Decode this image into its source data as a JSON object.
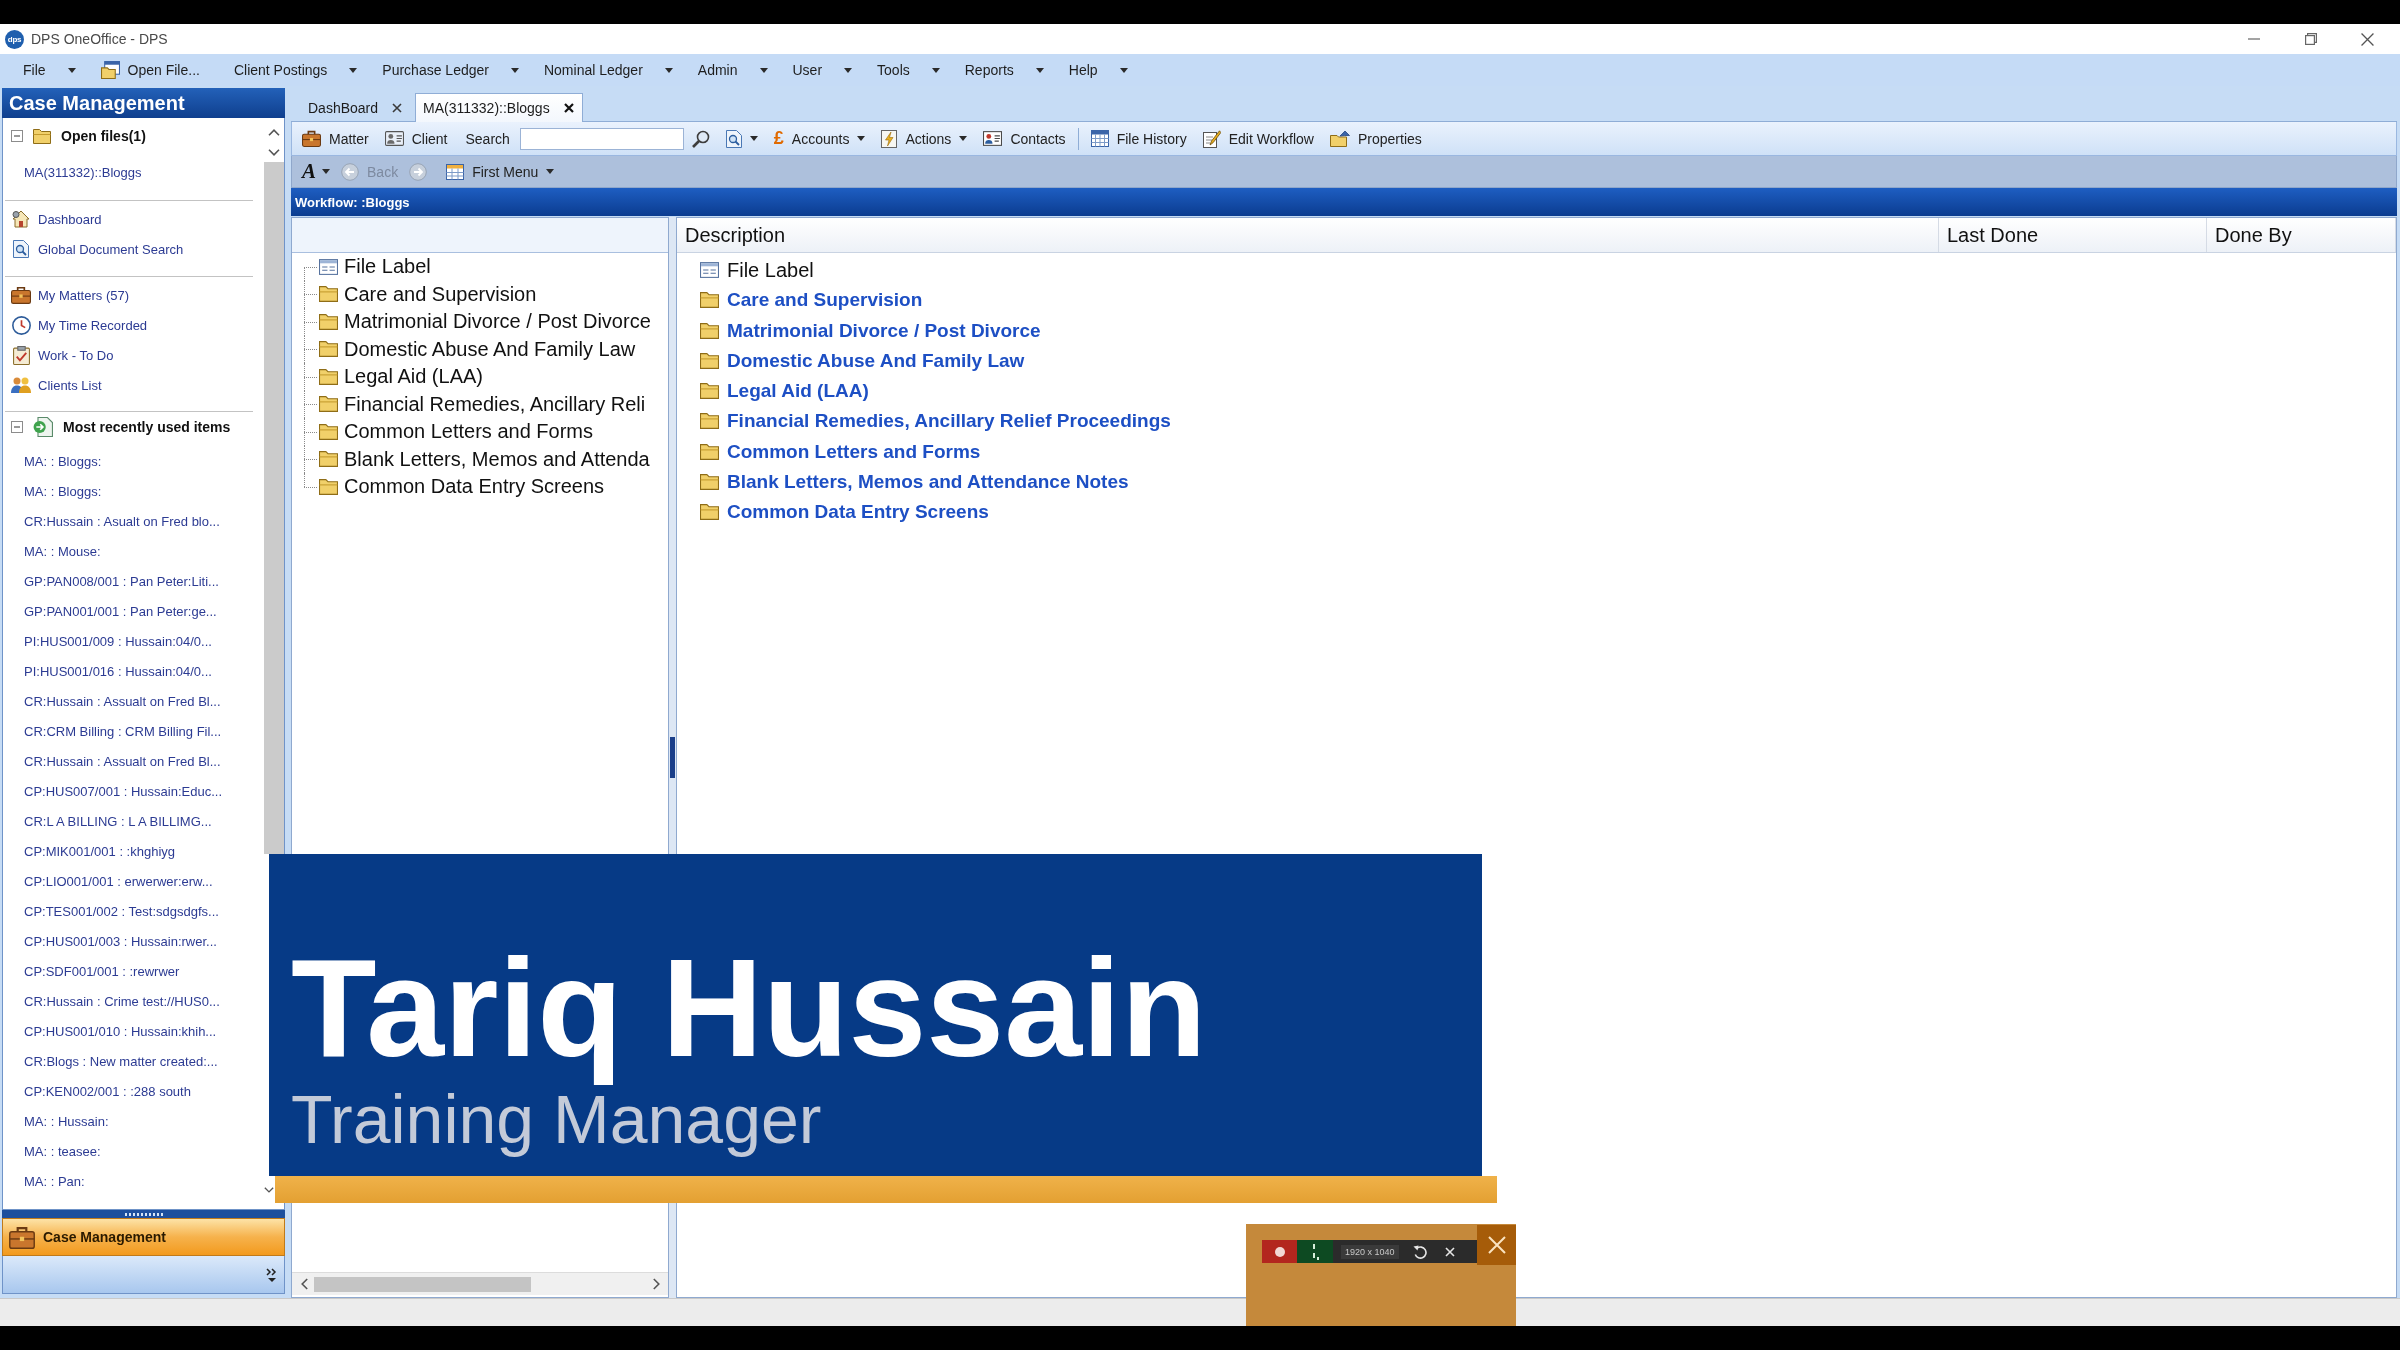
{
  "window": {
    "logo_text": "dps",
    "title": "DPS OneOffice - DPS"
  },
  "menu_bar": [
    {
      "kind": "dropdown",
      "label": "File"
    },
    {
      "kind": "command",
      "label": "Open File..."
    },
    {
      "kind": "dropdown",
      "label": "Client Postings"
    },
    {
      "kind": "dropdown",
      "label": "Purchase Ledger"
    },
    {
      "kind": "dropdown",
      "label": "Nominal Ledger"
    },
    {
      "kind": "dropdown",
      "label": "Admin"
    },
    {
      "kind": "dropdown",
      "label": "User"
    },
    {
      "kind": "dropdown",
      "label": "Tools"
    },
    {
      "kind": "dropdown",
      "label": "Reports"
    },
    {
      "kind": "dropdown",
      "label": "Help"
    }
  ],
  "sidebar": {
    "title": "Case Management",
    "open_files": {
      "label": "Open files(1)",
      "expanded": true,
      "items": [
        "MA(311332)::Bloggs"
      ]
    },
    "links": [
      "Dashboard",
      "Global Document Search"
    ],
    "my_links": [
      "My Matters (57)",
      "My Time Recorded",
      "Work - To Do",
      "Clients List"
    ],
    "recent": {
      "label": "Most recently used items",
      "expanded": true,
      "items": [
        "MA: : Bloggs:",
        "MA: : Bloggs:",
        "CR:Hussain : Asualt on Fred blo...",
        "MA: : Mouse:",
        "GP:PAN008/001 : Pan Peter:Liti...",
        "GP:PAN001/001 : Pan Peter:ge...",
        "PI:HUS001/009 : Hussain:04/0...",
        "PI:HUS001/016 : Hussain:04/0...",
        "CR:Hussain : Assualt on Fred Bl...",
        "CR:CRM Billing : CRM Billing Fil...",
        "CR:Hussain : Assualt on Fred Bl...",
        "CP:HUS007/001 : Hussain:Educ...",
        "CR:L A BILLING : L A BILLIMG...",
        "CP:MIK001/001 : :khghiyg",
        "CP:LIO001/001 : erwerwer:erw...",
        "CP:TES001/002 : Test:sdgsdgfs...",
        "CP:HUS001/003 : Hussain:rwer...",
        "CP:SDF001/001 : :rewrwer",
        "CR:Hussain : Crime test://HUS0...",
        "CP:HUS001/010 : Hussain:khih...",
        "CR:Blogs : New matter created:...",
        "CP:KEN002/001 : :288 south",
        "MA: : Hussain:",
        "MA: : teasee:",
        "MA: : Pan:"
      ]
    },
    "nav_button": "Case Management"
  },
  "tabs": [
    {
      "label": "DashBoard",
      "selected": false
    },
    {
      "label": "MA(311332)::Bloggs",
      "selected": true
    }
  ],
  "toolbar": {
    "matter": "Matter",
    "client": "Client",
    "search_label": "Search",
    "accounts_symbol": "£",
    "accounts": "Accounts",
    "actions": "Actions",
    "contacts": "Contacts",
    "file_history": "File History",
    "edit_workflow": "Edit Workflow",
    "properties": "Properties"
  },
  "toolbar2": {
    "font_button": "A",
    "back": {
      "label": "Back",
      "disabled": true
    },
    "forward": {
      "disabled": true
    },
    "first_menu": "First Menu"
  },
  "workflow": {
    "title": "Workflow: :Bloggs",
    "tree": [
      {
        "kind": "label",
        "label": "File Label"
      },
      {
        "kind": "folder",
        "label": "Care and Supervision"
      },
      {
        "kind": "folder",
        "label": "Matrimonial Divorce / Post Divorce"
      },
      {
        "kind": "folder",
        "label": "Domestic Abuse And Family Law"
      },
      {
        "kind": "folder",
        "label": "Legal Aid (LAA)"
      },
      {
        "kind": "folder",
        "label": "Financial Remedies, Ancillary Reli"
      },
      {
        "kind": "folder",
        "label": "Common Letters and Forms"
      },
      {
        "kind": "folder",
        "label": "Blank Letters, Memos and Attenda"
      },
      {
        "kind": "folder",
        "label": "Common Data Entry Screens"
      }
    ],
    "list": {
      "columns": [
        "Description",
        "Last Done",
        "Done By"
      ],
      "rows": [
        {
          "kind": "label",
          "description": "File Label"
        },
        {
          "kind": "folder",
          "description": "Care and Supervision"
        },
        {
          "kind": "folder",
          "description": "Matrimonial Divorce / Post Divorce"
        },
        {
          "kind": "folder",
          "description": "Domestic Abuse And Family Law"
        },
        {
          "kind": "folder",
          "description": "Legal Aid (LAA)"
        },
        {
          "kind": "folder",
          "description": "Financial Remedies, Ancillary Relief Proceedings"
        },
        {
          "kind": "folder",
          "description": "Common Letters and Forms"
        },
        {
          "kind": "folder",
          "description": "Blank Letters, Memos and Attendance Notes"
        },
        {
          "kind": "folder",
          "description": "Common Data Entry Screens"
        }
      ]
    }
  },
  "lower_third": {
    "name": "Tariq Hussain",
    "role": "Training Manager"
  },
  "recorder": {
    "resolution": "1920 x 1040"
  }
}
